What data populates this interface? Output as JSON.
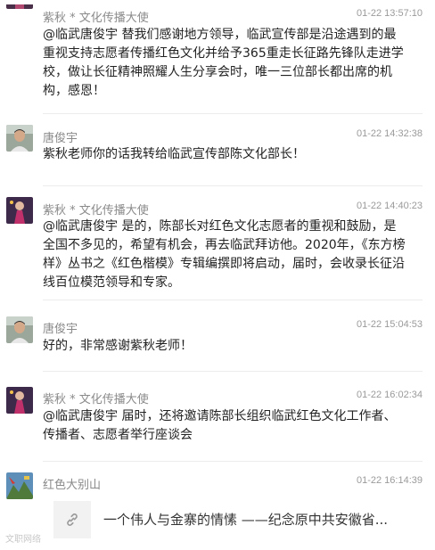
{
  "comments": [
    {
      "name": "紫秋 * 文化传播大使",
      "time": "01-22 13:57:10",
      "text": "@临武唐俊宇 替我们感谢地方领导，临武宣传部是沿途遇到的最重视支持志愿者传播红色文化并给予365重走长征路先锋队走进学校，做让长征精神照耀人生分享会时，唯一三位部长都出席的机构，感恩！",
      "avatar_icon": "portrait-woman-avatar"
    },
    {
      "name": "唐俊宇",
      "time": "01-22 14:32:38",
      "text": "紫秋老师你的话我转给临武宣传部陈文化部长！",
      "avatar_icon": "portrait-man-avatar"
    },
    {
      "name": "紫秋 * 文化传播大使",
      "time": "01-22 14:40:23",
      "text": "@临武唐俊宇 是的，陈部长对红色文化志愿者的重视和鼓励，是全国不多见的，希望有机会，再去临武拜访他。2020年，《东方榜样》丛书之《红色楷模》专辑编撰即将启动，届时，会收录长征沿线百位模范领导和专家。",
      "avatar_icon": "portrait-woman-avatar"
    },
    {
      "name": "唐俊宇",
      "time": "01-22 15:04:53",
      "text": "好的，非常感谢紫秋老师！",
      "avatar_icon": "portrait-man-avatar"
    },
    {
      "name": "紫秋 * 文化传播大使",
      "time": "01-22 16:02:34",
      "text": "@临武唐俊宇 届时，还将邀请陈部长组织临武红色文化工作者、传播者、志愿者举行座谈会",
      "avatar_icon": "portrait-woman-avatar"
    },
    {
      "name": "红色大别山",
      "time": "01-22 16:14:39",
      "avatar_icon": "mountain-landscape-avatar",
      "link": {
        "title": "一个伟人与金寨的情愫 ——纪念原中共安徽省...",
        "icon": "link-icon"
      }
    }
  ],
  "watermark": "文职网络",
  "colors": {
    "name": "#8a8a8a",
    "time": "#9a9a9a",
    "text": "#222222",
    "divider": "#ececec"
  }
}
